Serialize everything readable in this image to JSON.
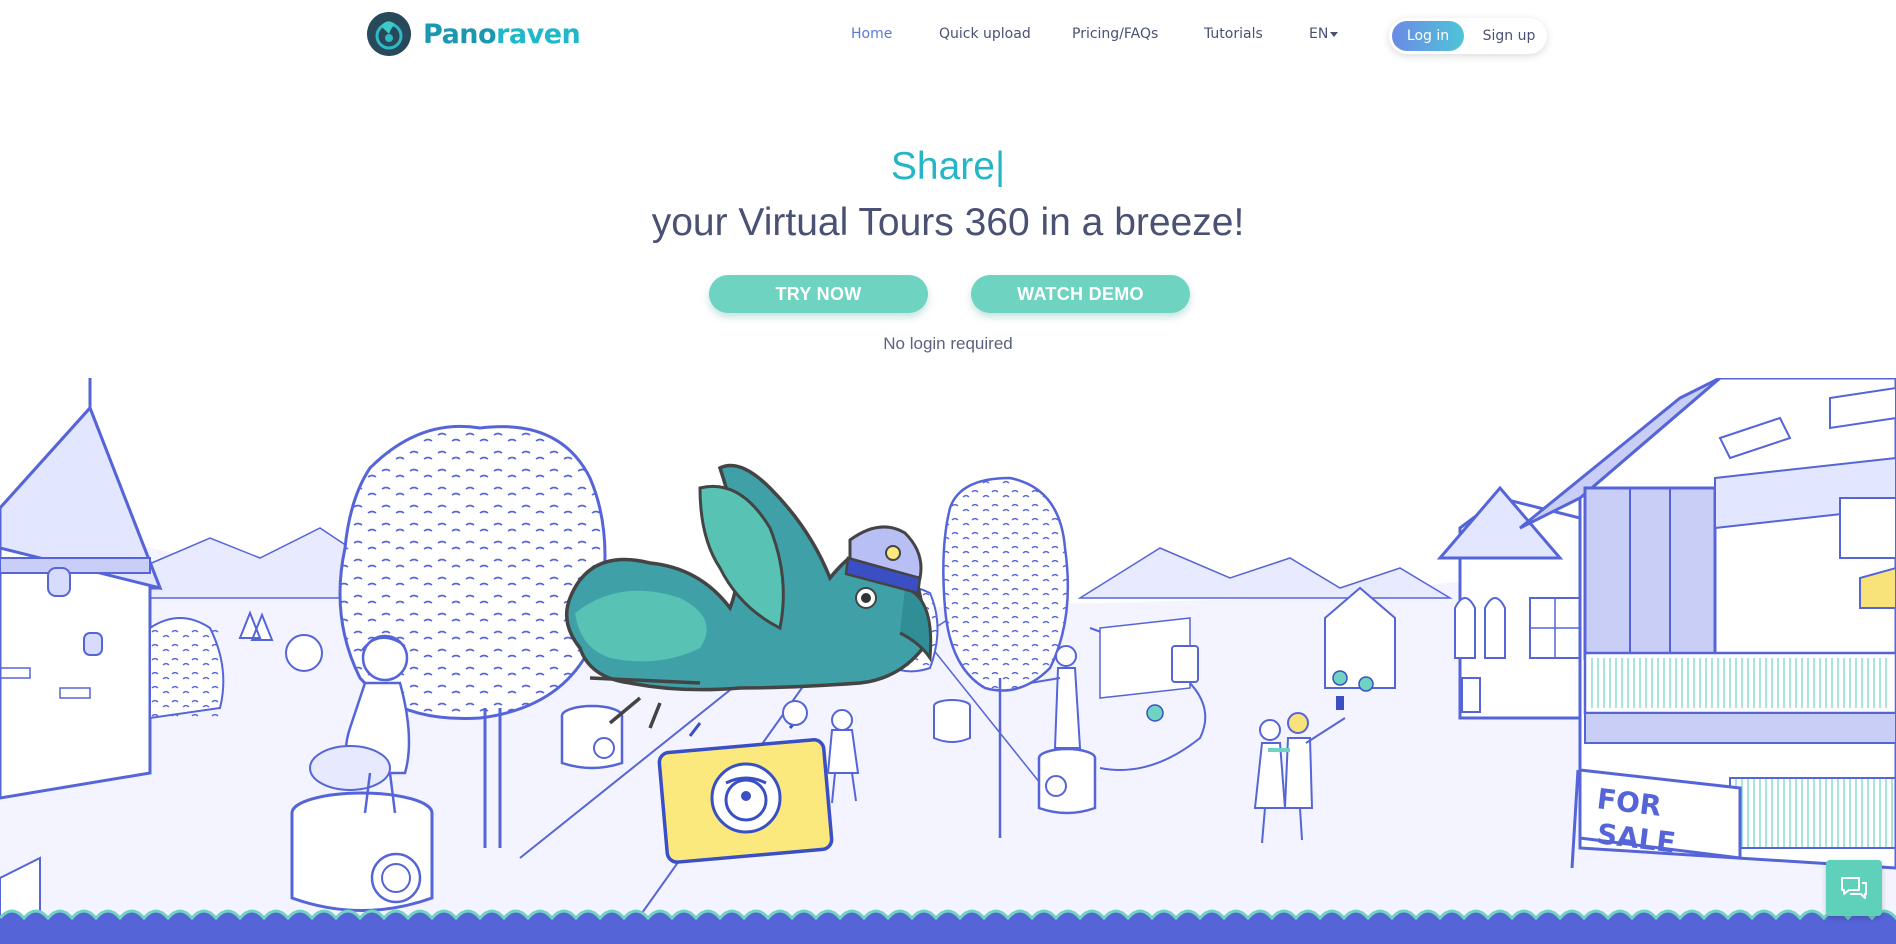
{
  "header": {
    "logo": {
      "part1": "Pano",
      "part2": "raven"
    },
    "nav": {
      "home": "Home",
      "quick_upload": "Quick upload",
      "pricing": "Pricing/FAQs",
      "tutorials": "Tutorials",
      "language": "EN"
    },
    "auth": {
      "login": "Log in",
      "signup": "Sign up"
    }
  },
  "hero": {
    "typed_word": "Share",
    "cursor": "|",
    "tagline": "your Virtual Tours 360 in a breeze!",
    "try_now": "TRY NOW",
    "watch_demo": "WATCH DEMO",
    "no_login": "No login required"
  },
  "illustration": {
    "sign_text": "FOR SALE"
  },
  "colors": {
    "brand_teal": "#24b5c6",
    "cta_green": "#6ed3c0",
    "line_blue": "#5565d8",
    "nav_active": "#5a79d6"
  },
  "icons": [
    "raven-logo-icon",
    "chevron-down-icon",
    "chat-icon"
  ]
}
